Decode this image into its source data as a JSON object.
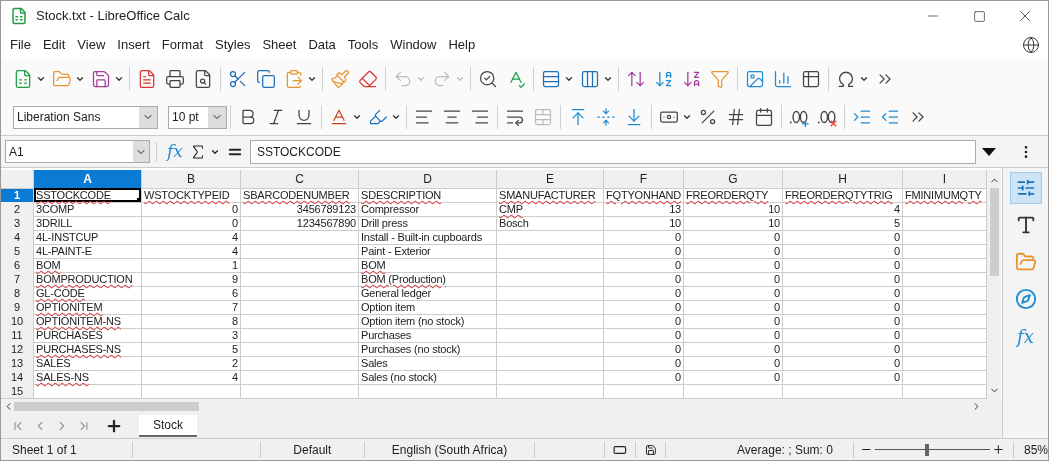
{
  "window": {
    "title": "Stock.txt - LibreOffice Calc"
  },
  "menu": [
    "File",
    "Edit",
    "View",
    "Insert",
    "Format",
    "Styles",
    "Sheet",
    "Data",
    "Tools",
    "Window",
    "Help"
  ],
  "formatting": {
    "font_name": "Liberation Sans",
    "font_size": "10 pt"
  },
  "formula_bar": {
    "name_box": "A1",
    "fx": "fx",
    "content": "SSTOCKCODE"
  },
  "columns": [
    {
      "label": "A",
      "selected": true
    },
    {
      "label": "B",
      "selected": false
    },
    {
      "label": "C",
      "selected": false
    },
    {
      "label": "D",
      "selected": false
    },
    {
      "label": "E",
      "selected": false
    },
    {
      "label": "F",
      "selected": false
    },
    {
      "label": "G",
      "selected": false
    },
    {
      "label": "H",
      "selected": false
    },
    {
      "label": "I",
      "selected": false
    }
  ],
  "rows": [
    {
      "number": "1",
      "selected": true,
      "cells": [
        {
          "text": "SSTOCKCODE",
          "misspelled": true,
          "active": true
        },
        {
          "text": "WSTOCKTYPEID",
          "misspelled": true
        },
        {
          "text": "SBARCODENUMBER",
          "misspelled": true
        },
        {
          "text": "SDESCRIPTION",
          "misspelled": true
        },
        {
          "text": "SMANUFACTURER",
          "misspelled": true
        },
        {
          "text": "FQTYONHAND",
          "misspelled": true
        },
        {
          "text": "FREORDERQTY",
          "misspelled": true
        },
        {
          "text": "FREORDERQTYTRIG",
          "misspelled": true
        },
        {
          "text": "FMINIMUMQTY",
          "misspelled": true
        }
      ]
    },
    {
      "number": "2",
      "selected": false,
      "cells": [
        {
          "text": "3COMP"
        },
        {
          "text": "0",
          "kind": "number"
        },
        {
          "text": "3456789123",
          "kind": "number"
        },
        {
          "text": "Compressor"
        },
        {
          "text": "CMP",
          "misspelled": true
        },
        {
          "text": "13",
          "kind": "number"
        },
        {
          "text": "10",
          "kind": "number"
        },
        {
          "text": "4",
          "kind": "number"
        },
        null
      ]
    },
    {
      "number": "3",
      "selected": false,
      "cells": [
        {
          "text": "3DRILL"
        },
        {
          "text": "0",
          "kind": "number"
        },
        {
          "text": "1234567890",
          "kind": "number"
        },
        {
          "text": "Drill press"
        },
        {
          "text": "Bosch"
        },
        {
          "text": "10",
          "kind": "number"
        },
        {
          "text": "10",
          "kind": "number"
        },
        {
          "text": "5",
          "kind": "number"
        },
        null
      ]
    },
    {
      "number": "4",
      "selected": false,
      "cells": [
        {
          "text": "4L-INSTCUP"
        },
        {
          "text": "4",
          "kind": "number"
        },
        null,
        {
          "text": "Install - Built-in cupboards"
        },
        null,
        {
          "text": "0",
          "kind": "number"
        },
        {
          "text": "0",
          "kind": "number"
        },
        {
          "text": "0",
          "kind": "number"
        },
        null
      ]
    },
    {
      "number": "5",
      "selected": false,
      "cells": [
        {
          "text": "4L-PAINT-E"
        },
        {
          "text": "4",
          "kind": "number"
        },
        null,
        {
          "text": "Paint - Exterior"
        },
        null,
        {
          "text": "0",
          "kind": "number"
        },
        {
          "text": "0",
          "kind": "number"
        },
        {
          "text": "0",
          "kind": "number"
        },
        null
      ]
    },
    {
      "number": "6",
      "selected": false,
      "cells": [
        {
          "text": "BOM",
          "misspelled": true
        },
        {
          "text": "1",
          "kind": "number"
        },
        null,
        {
          "text": "BOM",
          "misspelled": true
        },
        null,
        {
          "text": "0",
          "kind": "number"
        },
        {
          "text": "0",
          "kind": "number"
        },
        {
          "text": "0",
          "kind": "number"
        },
        null
      ]
    },
    {
      "number": "7",
      "selected": false,
      "cells": [
        {
          "text": "BOMPRODUCTION",
          "misspelled": true
        },
        {
          "text": "9",
          "kind": "number"
        },
        null,
        {
          "text": "BOM (Production)",
          "misspelled": true
        },
        null,
        {
          "text": "0",
          "kind": "number"
        },
        {
          "text": "0",
          "kind": "number"
        },
        {
          "text": "0",
          "kind": "number"
        },
        null
      ]
    },
    {
      "number": "8",
      "selected": false,
      "cells": [
        {
          "text": "GL-CODE",
          "misspelled": true
        },
        {
          "text": "6",
          "kind": "number"
        },
        null,
        {
          "text": "General ledger"
        },
        null,
        {
          "text": "0",
          "kind": "number"
        },
        {
          "text": "0",
          "kind": "number"
        },
        {
          "text": "0",
          "kind": "number"
        },
        null
      ]
    },
    {
      "number": "9",
      "selected": false,
      "cells": [
        {
          "text": "OPTIONITEM",
          "misspelled": true
        },
        {
          "text": "7",
          "kind": "number"
        },
        null,
        {
          "text": "Option item"
        },
        null,
        {
          "text": "0",
          "kind": "number"
        },
        {
          "text": "0",
          "kind": "number"
        },
        {
          "text": "0",
          "kind": "number"
        },
        null
      ]
    },
    {
      "number": "10",
      "selected": false,
      "cells": [
        {
          "text": "OPTIONITEM-NS",
          "misspelled": true
        },
        {
          "text": "8",
          "kind": "number"
        },
        null,
        {
          "text": "Option item (no stock)"
        },
        null,
        {
          "text": "0",
          "kind": "number"
        },
        {
          "text": "0",
          "kind": "number"
        },
        {
          "text": "0",
          "kind": "number"
        },
        null
      ]
    },
    {
      "number": "11",
      "selected": false,
      "cells": [
        {
          "text": "PURCHASES"
        },
        {
          "text": "3",
          "kind": "number"
        },
        null,
        {
          "text": "Purchases"
        },
        null,
        {
          "text": "0",
          "kind": "number"
        },
        {
          "text": "0",
          "kind": "number"
        },
        {
          "text": "0",
          "kind": "number"
        },
        null
      ]
    },
    {
      "number": "12",
      "selected": false,
      "cells": [
        {
          "text": "PURCHASES-NS",
          "misspelled": true
        },
        {
          "text": "5",
          "kind": "number"
        },
        null,
        {
          "text": "Purchases (no stock)"
        },
        null,
        {
          "text": "0",
          "kind": "number"
        },
        {
          "text": "0",
          "kind": "number"
        },
        {
          "text": "0",
          "kind": "number"
        },
        null
      ]
    },
    {
      "number": "13",
      "selected": false,
      "cells": [
        {
          "text": "SALES"
        },
        {
          "text": "2",
          "kind": "number"
        },
        null,
        {
          "text": "Sales"
        },
        null,
        {
          "text": "0",
          "kind": "number"
        },
        {
          "text": "0",
          "kind": "number"
        },
        {
          "text": "0",
          "kind": "number"
        },
        null
      ]
    },
    {
      "number": "14",
      "selected": false,
      "cells": [
        {
          "text": "SALES-NS",
          "misspelled": true
        },
        {
          "text": "4",
          "kind": "number"
        },
        null,
        {
          "text": "Sales (no stock)"
        },
        null,
        {
          "text": "0",
          "kind": "number"
        },
        {
          "text": "0",
          "kind": "number"
        },
        {
          "text": "0",
          "kind": "number"
        },
        null
      ]
    },
    {
      "number": "15",
      "selected": false,
      "cells": [
        null,
        null,
        null,
        null,
        null,
        null,
        null,
        null,
        null
      ]
    }
  ],
  "sheet_tabs": [
    {
      "label": "Stock",
      "selected": true
    }
  ],
  "sidebar": [
    {
      "kind": "properties",
      "selected": true
    },
    {
      "kind": "styles",
      "selected": false
    },
    {
      "kind": "gallery",
      "selected": false
    },
    {
      "kind": "navigator",
      "selected": false
    },
    {
      "kind": "functions",
      "label": "fx",
      "selected": false
    }
  ],
  "status_bar": {
    "sheet": "Sheet 1 of 1",
    "page_style": "Default",
    "language": "English (South Africa)",
    "summary": "Average: ; Sum: 0",
    "zoom": {
      "level": 0.45
    },
    "zoom_text": "85%"
  }
}
